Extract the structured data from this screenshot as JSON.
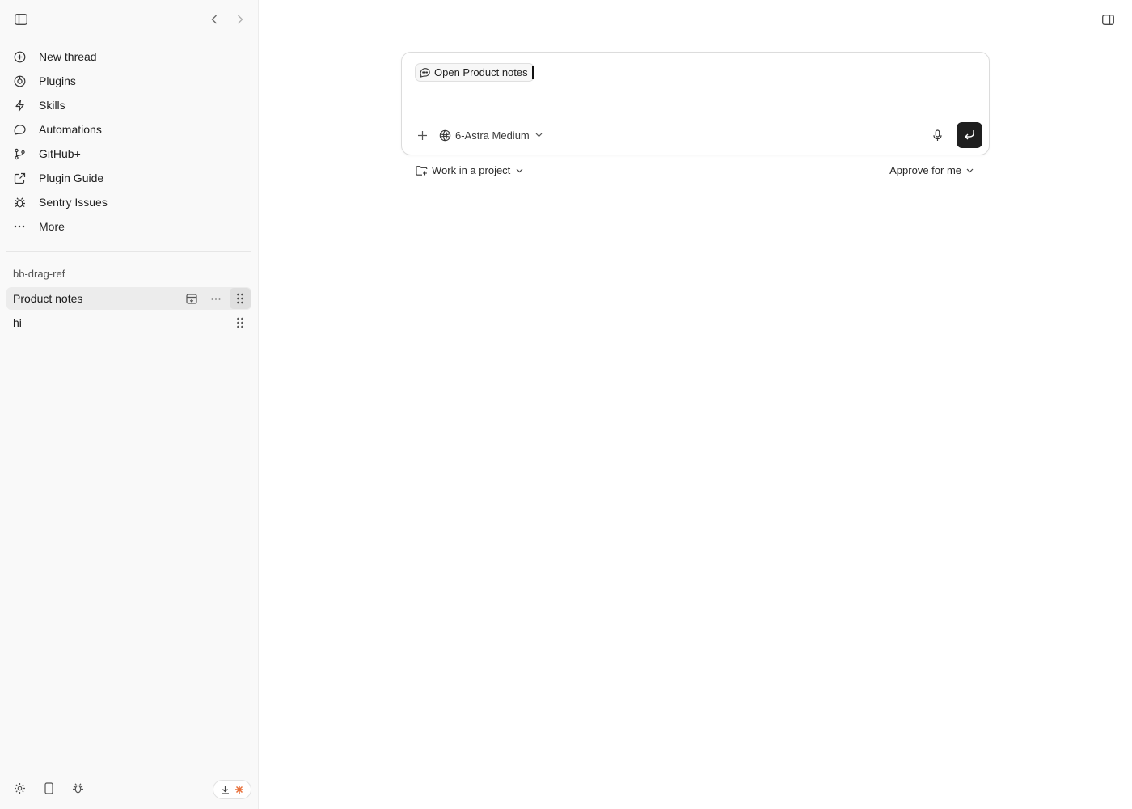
{
  "sidebar": {
    "toggle_icon": "sidebar-toggle-icon",
    "back_icon": "chevron-left-icon",
    "forward_icon": "chevron-right-icon",
    "nav_items": [
      {
        "label": "New thread",
        "icon": "plus-circle-icon"
      },
      {
        "label": "Plugins",
        "icon": "plugin-icon"
      },
      {
        "label": "Skills",
        "icon": "bolt-icon"
      },
      {
        "label": "Automations",
        "icon": "chat-loop-icon"
      },
      {
        "label": "GitHub+",
        "icon": "github-icon"
      },
      {
        "label": "Plugin Guide",
        "icon": "external-doc-icon"
      },
      {
        "label": "Sentry Issues",
        "icon": "bug-icon"
      },
      {
        "label": "More",
        "icon": "ellipsis-icon"
      }
    ],
    "section_label": "bb-drag-ref",
    "threads": [
      {
        "title": "Product notes",
        "active": true
      },
      {
        "title": "hi",
        "active": false
      }
    ],
    "bottom": {
      "settings_icon": "gear-icon",
      "device_icon": "phone-icon",
      "debug_icon": "bug-icon"
    }
  },
  "composer": {
    "chip_label": "Open Product notes",
    "input_value": "",
    "model_label": "6-Astra Medium",
    "project_label": "Work in a project",
    "approval_label": "Approve for me"
  },
  "colors": {
    "sidebar_bg": "#f9f9f9",
    "active_row_bg": "#ececec",
    "send_button_bg": "#1f1f1f",
    "accent_orange": "#e8703a"
  }
}
